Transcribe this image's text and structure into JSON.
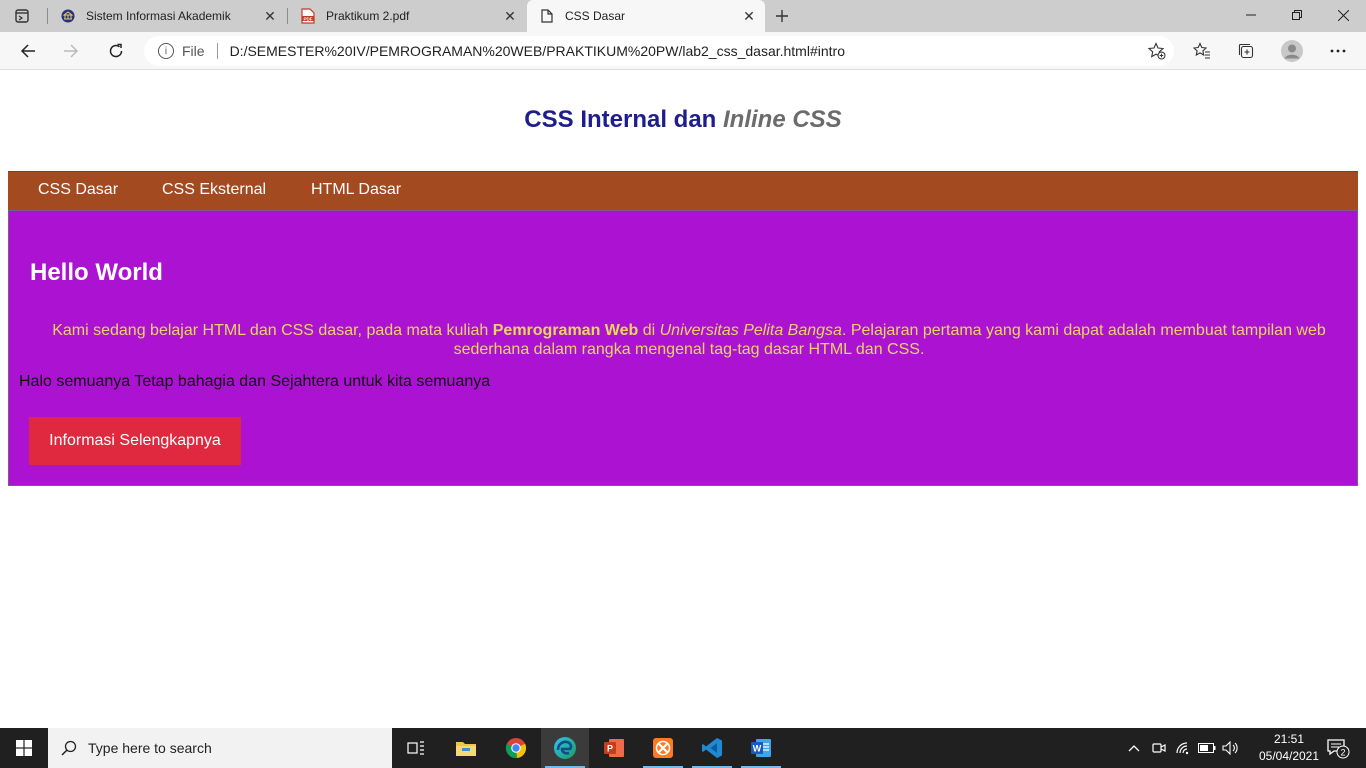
{
  "browser": {
    "tabs": [
      {
        "title": "Sistem Informasi Akademik",
        "icon": "university-icon"
      },
      {
        "title": "Praktikum 2.pdf",
        "icon": "pdf-icon"
      },
      {
        "title": "CSS Dasar",
        "icon": "page-icon"
      }
    ],
    "address": {
      "scheme_label": "File",
      "url": "D:/SEMESTER%20IV/PEMROGRAMAN%20WEB/PRAKTIKUM%20PW/lab2_css_dasar.html#intro"
    }
  },
  "page": {
    "title_main": "CSS Internal dan ",
    "title_em": "Inline CSS",
    "nav": [
      "CSS Dasar",
      "CSS Eksternal",
      "HTML Dasar"
    ],
    "intro": {
      "heading": "Hello World",
      "lead_1": "Kami sedang belajar HTML dan CSS dasar, pada mata kuliah ",
      "lead_bold": "Pemrograman Web",
      "lead_2": " di ",
      "lead_italic": "Universitas Pelita Bangsa",
      "lead_3": ". Pelajaran pertama yang kami dapat adalah membuat tampilan web sederhana dalam rangka mengenal tag-tag dasar HTML dan CSS.",
      "plain": "Halo semuanya Tetap bahagia dan Sejahtera untuk kita semuanya",
      "button": "Informasi Selengkapnya"
    },
    "colors": {
      "title": "#1d1d8c",
      "nav_bg": "#a44a20",
      "intro_bg": "#ac12d2",
      "lead_text": "#e8d660",
      "button_bg": "#e0283e"
    }
  },
  "taskbar": {
    "search_placeholder": "Type here to search",
    "time": "21:51",
    "date": "05/04/2021",
    "notification_count": "2"
  }
}
